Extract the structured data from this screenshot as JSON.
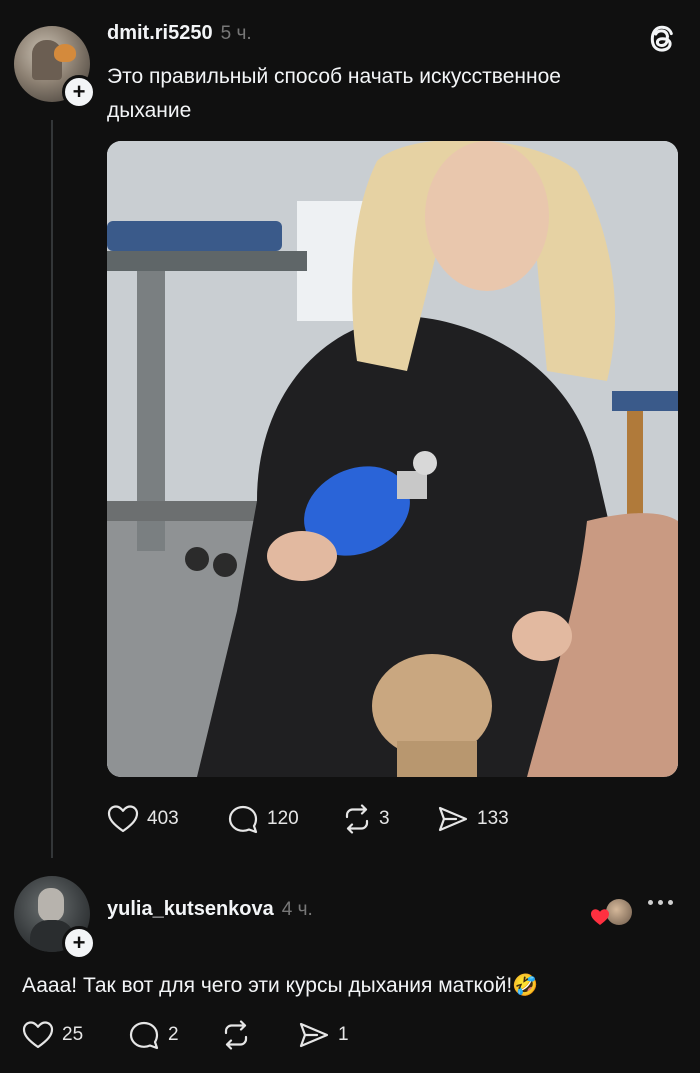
{
  "post": {
    "username": "dmit.ri5250",
    "time": "5 ч.",
    "text_line1": "Это правильный способ начать искусственное",
    "text_line2": "дыхание",
    "image_alt": "Photo: woman kneeling over CPR mannequin holding a blue bag-valve mask",
    "likes": "403",
    "comments": "120",
    "reposts": "3",
    "shares": "133"
  },
  "reply": {
    "username": "yulia_kutsenkova",
    "time": "4 ч.",
    "text": "Аааа! Так вот для чего эти курсы дыхания маткой!",
    "emoji": "🤣",
    "likes": "25",
    "comments": "2",
    "reposts": "",
    "shares": "1"
  },
  "icons": {
    "app": "threads-icon",
    "like": "heart-icon",
    "comment": "comment-icon",
    "repost": "repost-icon",
    "share": "send-icon",
    "more": "more-icon",
    "follow": "plus-icon"
  },
  "colors": {
    "background": "#101010",
    "text": "#f3f5f7",
    "secondary": "#777777",
    "liked_heart": "#ff3040"
  }
}
